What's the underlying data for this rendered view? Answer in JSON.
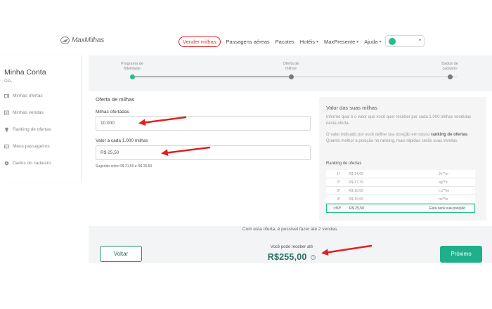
{
  "header": {
    "logo_text": "MaxMilhas",
    "nav": [
      {
        "label": "Vender milhas"
      },
      {
        "label": "Passagens aéreas"
      },
      {
        "label": "Pacotes"
      },
      {
        "label": "Hotéis"
      },
      {
        "label": "MaxPresente"
      },
      {
        "label": "Ajuda"
      }
    ]
  },
  "sidebar": {
    "title": "Minha Conta",
    "subtitle": "Olá,",
    "items": [
      {
        "label": "Minhas ofertas",
        "icon": "wallet-icon"
      },
      {
        "label": "Minhas vendas",
        "icon": "sales-icon"
      },
      {
        "label": "Ranking de ofertas",
        "icon": "trophy-icon"
      },
      {
        "label": "Meus passageiros",
        "icon": "passengers-icon"
      },
      {
        "label": "Dados do cadastro",
        "icon": "settings-icon"
      }
    ]
  },
  "steps": [
    {
      "label_line1": "Programa de",
      "label_line2": "fidelidade"
    },
    {
      "label_line1": "Oferta de",
      "label_line2": "milhas"
    },
    {
      "label_line1": "Dados de",
      "label_line2": "cadastro"
    }
  ],
  "form": {
    "title": "Oferta de milhas",
    "miles_label": "Milhas ofertadas",
    "miles_value": "10.000",
    "price_label": "Valor a cada 1.000 milhas",
    "price_value": "R$ 25,50",
    "hint": "Sugerido entre R$ 21,50 e R$ 25,50"
  },
  "info": {
    "title": "Valor das suas milhas",
    "text1": "Informe qual é o valor que você quer receber por cada 1.000 milhas vendidas nesta oferta.",
    "text2_a": "O valor indicado por você define sua posição em nosso ",
    "text2_b": "ranking de ofertas",
    "text2_c": ". Quanto melhor a posição no ranking, mais rápidas serão suas vendas.",
    "ranking_title": "Ranking de ofertas",
    "ranking": [
      {
        "pos": "1º",
        "value": "R$ 14,00",
        "user": "Je**er"
      },
      {
        "pos": "2º",
        "value": "R$ 17,70",
        "user": "ag**ir"
      },
      {
        "pos": "3º",
        "value": "R$ 18,00",
        "user": "Lu**ke"
      },
      {
        "pos": "4º",
        "value": "R$ 19,00",
        "user": "mi**le"
      },
      {
        "pos": ">50º",
        "value": "R$ 25,50",
        "user": "Esta será sua posição"
      }
    ]
  },
  "note": "Com esta oferta, é possível fazer até 2 vendas.",
  "footer": {
    "back_label": "Voltar",
    "receive_label": "Você pode receber até",
    "amount": "R$255,00",
    "help_icon": "?",
    "next_label": "Próximo"
  },
  "colors": {
    "accent": "#1faf8a",
    "annotation": "#e02020"
  }
}
